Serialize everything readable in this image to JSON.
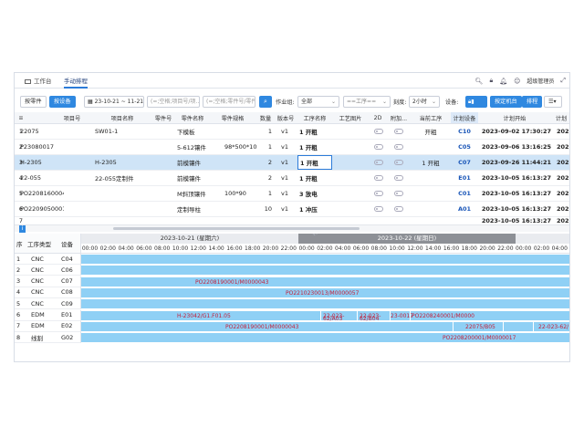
{
  "tabs": [
    {
      "label": "工作台"
    },
    {
      "label": "手动排程"
    }
  ],
  "topbar": {
    "user": "超级管理员"
  },
  "toolbar": {
    "btn_parts": "按零件",
    "btn_equipment": "按设备",
    "date_range": "23-10-21 ~ 11-21",
    "input_order_placeholder": "(=;空格;项目号/项...",
    "input_part_placeholder": "(=;空格;零件号/零件名...",
    "workshop_label": "作业组:",
    "workshop_value": "全部",
    "process_value": "==工序==",
    "hours_label": "刻度:",
    "hours_value": "2小时",
    "equipment_label": "设备:",
    "lock_label": "",
    "btn_fixed": "按定机台",
    "btn_schedule": "排程"
  },
  "grid": {
    "headers": [
      "项目号",
      "项目名称",
      "零件号",
      "零件名称",
      "零件规格",
      "数量",
      "版本号",
      "工序名称",
      "工艺图片",
      "2D",
      "附加...",
      "当前工序",
      "计划设备",
      "计划开始",
      "计划"
    ],
    "rows": [
      {
        "no": "1",
        "project": "22075",
        "name": "SW01-1",
        "part": "",
        "part_name": "下模板",
        "spec": "",
        "qty": "1",
        "ver": "v1",
        "proc": "1 开粗",
        "cur": "开粗",
        "equip": "C10",
        "start": "2023-09-02 17:30:27",
        "end": "2023-1"
      },
      {
        "no": "2",
        "project": "P23080017",
        "name": "",
        "part": "",
        "part_name": "5-612镶件",
        "spec": "98*500*100",
        "qty": "1",
        "ver": "v1",
        "proc": "1 开粗",
        "cur": "",
        "equip": "C05",
        "start": "2023-09-06 13:16:25",
        "end": "2023-0"
      },
      {
        "no": "3",
        "project": "H-2305",
        "name": "H-2305",
        "part": "",
        "part_name": "前模镶件",
        "spec": "",
        "qty": "2",
        "ver": "v1",
        "proc": "1 开粗",
        "cur": "1 开粗",
        "equip": "C07",
        "start": "2023-09-26 11:44:21",
        "end": "2023-1"
      },
      {
        "no": "4",
        "project": "22-055",
        "name": "22-055定制件",
        "part": "",
        "part_name": "前模镶件",
        "spec": "",
        "qty": "2",
        "ver": "v1",
        "proc": "1 开粗",
        "cur": "",
        "equip": "E01",
        "start": "2023-10-05 16:13:27",
        "end": "2023-1"
      },
      {
        "no": "5",
        "project": "PO2208160004",
        "name": "",
        "part": "",
        "part_name": "M斜顶镶件",
        "spec": "100*90",
        "qty": "1",
        "ver": "v1",
        "proc": "3 放电",
        "cur": "",
        "equip": "C01",
        "start": "2023-10-05 16:13:27",
        "end": "2023-1"
      },
      {
        "no": "6",
        "project": "PO2209050001",
        "name": "",
        "part": "",
        "part_name": "定制导柱",
        "spec": "",
        "qty": "10",
        "ver": "v1",
        "proc": "1 冲压",
        "cur": "",
        "equip": "A01",
        "start": "2023-10-05 16:13:27",
        "end": "2023-1"
      }
    ],
    "partial_row": {
      "no": "7",
      "start": "2023-10-05 16:13:27",
      "end": "2023-1"
    }
  },
  "gantt": {
    "left_headers": [
      "序",
      "工序类型",
      "设备"
    ],
    "day1": "2023-10-21 (星期六)",
    "day2": "2023-10-22 (星期日)",
    "hours": [
      "00:00",
      "02:00",
      "04:00",
      "06:00",
      "08:00",
      "10:00",
      "12:00",
      "14:00",
      "16:00",
      "18:00",
      "20:00",
      "22:00",
      "00:00",
      "02:00",
      "04:00",
      "06:00",
      "08:00",
      "10:00",
      "12:00",
      "14:00",
      "16:00",
      "18:00",
      "20:00",
      "22:00",
      "00:00",
      "02:00",
      "04:00",
      "06:00"
    ],
    "rows": [
      {
        "no": "1",
        "type": "CNC",
        "equip": "C04"
      },
      {
        "no": "2",
        "type": "CNC",
        "equip": "C06"
      },
      {
        "no": "3",
        "type": "CNC",
        "equip": "C07"
      },
      {
        "no": "4",
        "type": "CNC",
        "equip": "C08"
      },
      {
        "no": "5",
        "type": "CNC",
        "equip": "C09"
      },
      {
        "no": "6",
        "type": "EDM",
        "equip": "E01"
      },
      {
        "no": "7",
        "type": "EDM",
        "equip": "E02"
      },
      {
        "no": "8",
        "type": "线割",
        "equip": "G02"
      }
    ],
    "labels": {
      "c07": "PO2208190001/M0000043",
      "c08": "PO2210230013/M0000057",
      "e01_a": "H-23042/G1.F01.05",
      "e01_b1": "22-023-",
      "e01_b2": "62/A03",
      "e01_c1": "22-023-",
      "e01_c2": "62/B04",
      "e01_d": "23-0017",
      "e01_e": "PO2208240001/M0000",
      "e02_a": "PO2208190001/M0000043",
      "e02_b": "22075/B05",
      "e02_c": "22-023-62/",
      "g02": "PO2208200001/M0000017"
    }
  }
}
